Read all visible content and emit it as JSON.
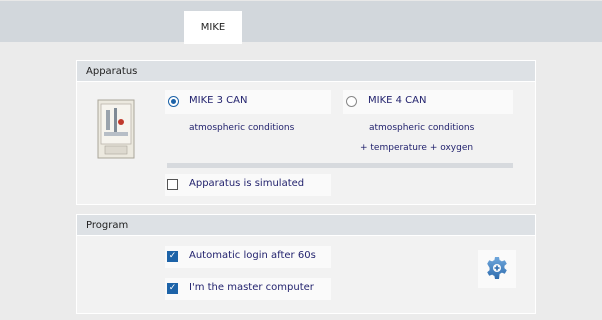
{
  "tabs": [
    {
      "label": "MIKE"
    }
  ],
  "apparatus": {
    "header": "Apparatus",
    "options": [
      {
        "label": "MIKE 3 CAN",
        "desc1": "atmospheric conditions",
        "desc2": "",
        "selected": true
      },
      {
        "label": "MIKE 4 CAN",
        "desc1": "atmospheric conditions",
        "desc2": "+ temperature + oxygen",
        "selected": false
      }
    ],
    "simulated": {
      "label": "Apparatus is simulated",
      "checked": false
    }
  },
  "program": {
    "header": "Program",
    "auto_login": {
      "label": "Automatic login after 60s",
      "checked": true
    },
    "master": {
      "label": "I'm the master computer",
      "checked": true
    }
  },
  "colors": {
    "accent": "#1d63a8",
    "label_text": "#23236e",
    "tab_strip": "#d2d7dc"
  },
  "icons": {
    "apparatus_image": "apparatus-cabinet-icon",
    "settings": "gear-icon"
  }
}
